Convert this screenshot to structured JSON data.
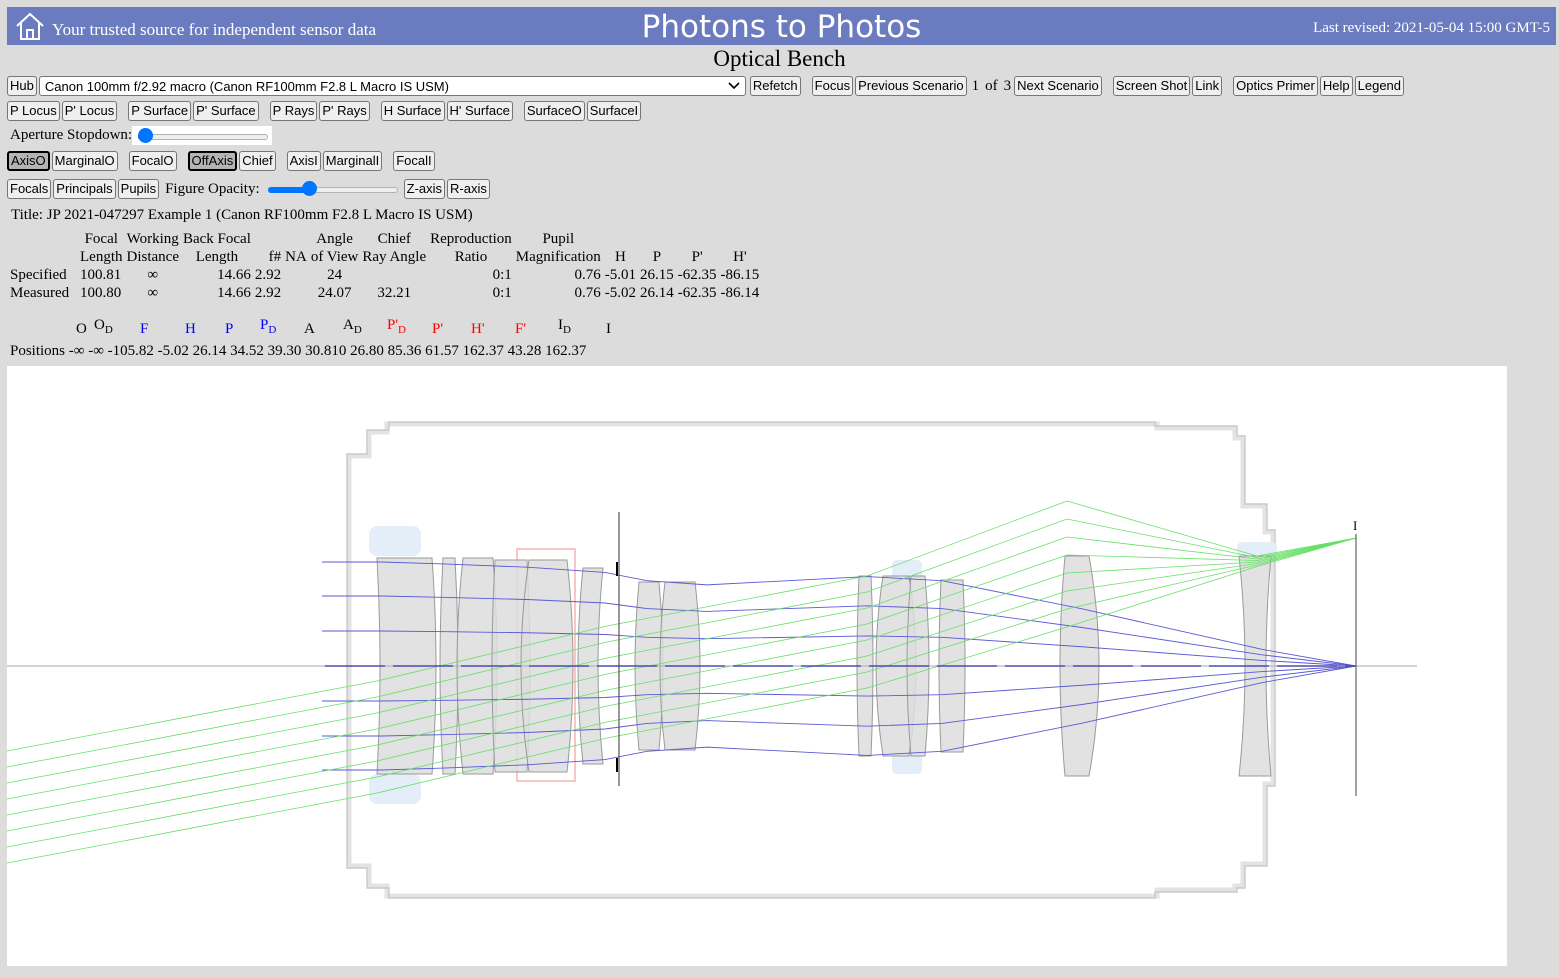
{
  "header": {
    "tagline": "Your trusted source for independent sensor data",
    "site_title": "Photons to Photos",
    "last_revised": "Last revised: 2021-05-04 15:00 GMT-5"
  },
  "page_title": "Optical Bench",
  "toolbar1": {
    "hub": "Hub",
    "lens_select": "Canon 100mm f/2.92 macro (Canon RF100mm F2.8 L Macro IS USM)",
    "refetch": "Refetch",
    "focus": "Focus",
    "previous_scenario": "Previous Scenario",
    "scenario_index": "1",
    "of": "of",
    "scenario_total": "3",
    "next_scenario": "Next Scenario",
    "screen_shot": "Screen Shot",
    "link": "Link",
    "optics_primer": "Optics Primer",
    "help": "Help",
    "legend": "Legend"
  },
  "toolbar2": [
    "P Locus",
    "P' Locus",
    "P Surface",
    "P' Surface",
    "P Rays",
    "P' Rays",
    "H Surface",
    "H' Surface",
    "SurfaceO",
    "SurfaceI"
  ],
  "aperture": {
    "label": "Aperture Stopdown:",
    "value": 0.0
  },
  "toolbar3": [
    "AxisO",
    "MarginalO",
    "FocalO",
    "OffAxis",
    "Chief",
    "AxisI",
    "MarginalI",
    "FocalI"
  ],
  "toolbar4": {
    "focals": "Focals",
    "principals": "Principals",
    "pupils": "Pupils",
    "opacity_label": "Figure Opacity:",
    "opacity_value": 0.3,
    "z_axis": "Z-axis",
    "r_axis": "R-axis"
  },
  "title_line": "Title: JP 2021-047297 Example 1 (Canon RF100mm F2.8 L Macro IS USM)",
  "spec_table": {
    "header1": [
      "",
      "Focal",
      "Working",
      "Back Focal",
      "",
      "",
      "Angle",
      "Chief",
      "Reproduction",
      "Pupil",
      "",
      "",
      "",
      ""
    ],
    "header2": [
      "",
      "Length",
      "Distance",
      "Length",
      "f#",
      "NA",
      "of View",
      "Ray Angle",
      "Ratio",
      "Magnification",
      "H",
      "P",
      "P'",
      "H'"
    ],
    "specified": [
      "Specified",
      "100.81",
      "∞",
      "14.66",
      "2.92",
      "",
      "24",
      "",
      "0:1",
      "0.76",
      "-5.01",
      "26.15",
      "-62.35",
      "-86.15"
    ],
    "measured": [
      "Measured",
      "100.80",
      "∞",
      "14.66",
      "2.92",
      "",
      "24.07",
      "32.21",
      "0:1",
      "0.76",
      "-5.02",
      "26.14",
      "-62.35",
      "-86.14"
    ]
  },
  "symbols": {
    "O": "O",
    "OD": "O",
    "D": "D",
    "F": "F",
    "H": "H",
    "P": "P",
    "PD": "P",
    "A": "A",
    "AD": "A",
    "PpD": "P'",
    "Pp": "P'",
    "Hp": "H'",
    "Fp": "F'",
    "ID": "I",
    "I": "I"
  },
  "positions": "Positions -∞  -∞ -105.82 -5.02 26.14 34.52 39.30 30.810 26.80 85.36 61.57 162.37 43.28 162.37",
  "diagram": {
    "image_label": "I"
  }
}
